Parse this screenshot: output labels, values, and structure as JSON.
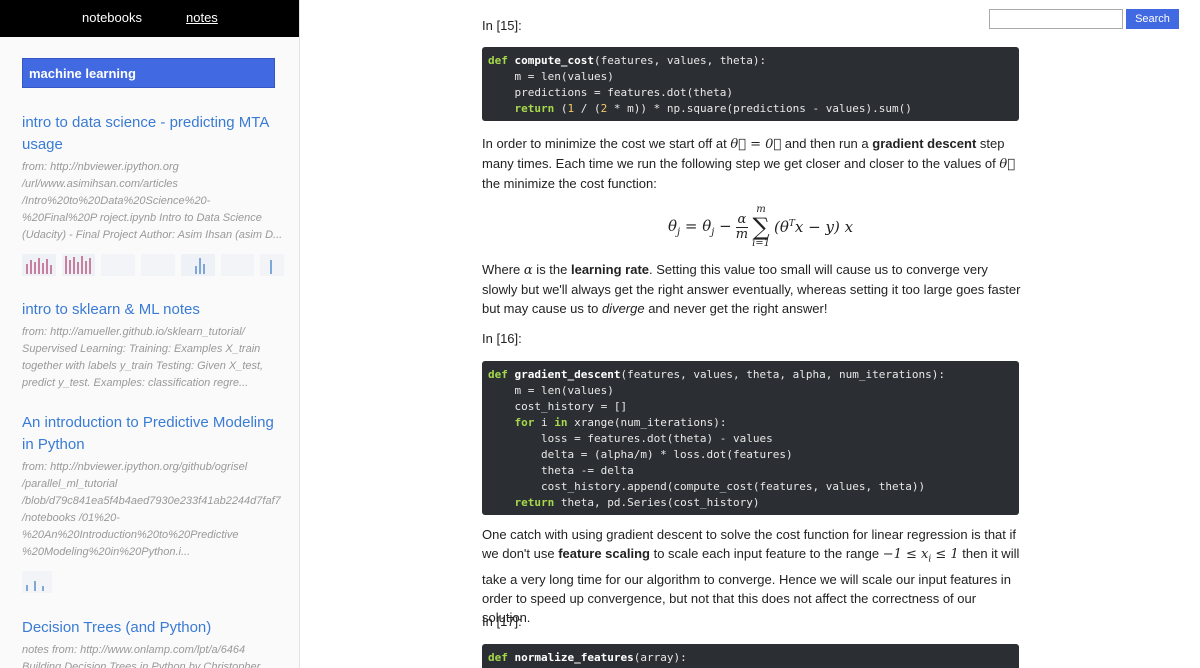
{
  "nav": {
    "notebooks": "notebooks",
    "notes": "notes"
  },
  "sidebar": {
    "category": "machine learning",
    "notes": [
      {
        "title": "intro to data science - predicting MTA usage",
        "desc": "from: http://nbviewer.ipython.org /url/www.asimihsan.com/articles /Intro%20to%20Data%20Science%20-%20Final%20P roject.ipynb Intro to Data Science (Udacity) - Final Project Author: Asim Ihsan (asim D..."
      },
      {
        "title": "intro to sklearn & ML notes",
        "desc": "from: http://amueller.github.io/sklearn_tutorial/ Supervised Learning: Training: Examples X_train together with labels y_train Testing: Given X_test, predict y_test. Examples: classification regre..."
      },
      {
        "title": "An introduction to Predictive Modeling in Python",
        "desc": "from: http://nbviewer.ipython.org/github/ogrisel /parallel_ml_tutorial /blob/d79c841ea5f4b4aed7930e233f41ab2244d7faf7 /notebooks /01%20-%20An%20Introduction%20to%20Predictive %20Modeling%20in%20Python.i..."
      },
      {
        "title": "Decision Trees (and Python)",
        "desc": "notes from: http://www.onlamp.com/lpt/a/6464 Building Decision Trees in Python by Christopher"
      }
    ]
  },
  "search": {
    "placeholder": "",
    "button": "Search"
  },
  "cells": {
    "p15": "In [15]:",
    "p16": "In [16]:",
    "p17": "In [17]:"
  },
  "text": {
    "para1_a": "In order to minimize the cost we start off at ",
    "para1_b": " and then run a ",
    "para1_bold": "gradient descent",
    "para1_c": " step many times. Each time we run the following step we get closer and closer to the values of ",
    "para1_d": " the minimize the cost function:",
    "para2_a": "Where ",
    "para2_b": " is the ",
    "para2_bold": "learning rate",
    "para2_c": ". Setting this value too small will cause us to converge very slowly but we'll always get the right answer eventually, whereas setting it too large goes faster but may cause us to ",
    "para2_em": "diverge",
    "para2_d": " and never get the right answer!",
    "para3_a": "One catch with using gradient descent to solve the cost function for linear regression is that if we don't use ",
    "para3_bold": "feature scaling",
    "para3_b": " to scale each input feature to the range ",
    "para3_c": " then it will take a very long time for our algorithm to converge. Hence we will scale our input features in order to speed up convergence, but not that this does not affect the correctness of our solution."
  },
  "colors": {
    "accent": "#4169e1",
    "link": "#3a7bd5",
    "code_bg": "#2b2f33",
    "keyword": "#a6d84a"
  }
}
